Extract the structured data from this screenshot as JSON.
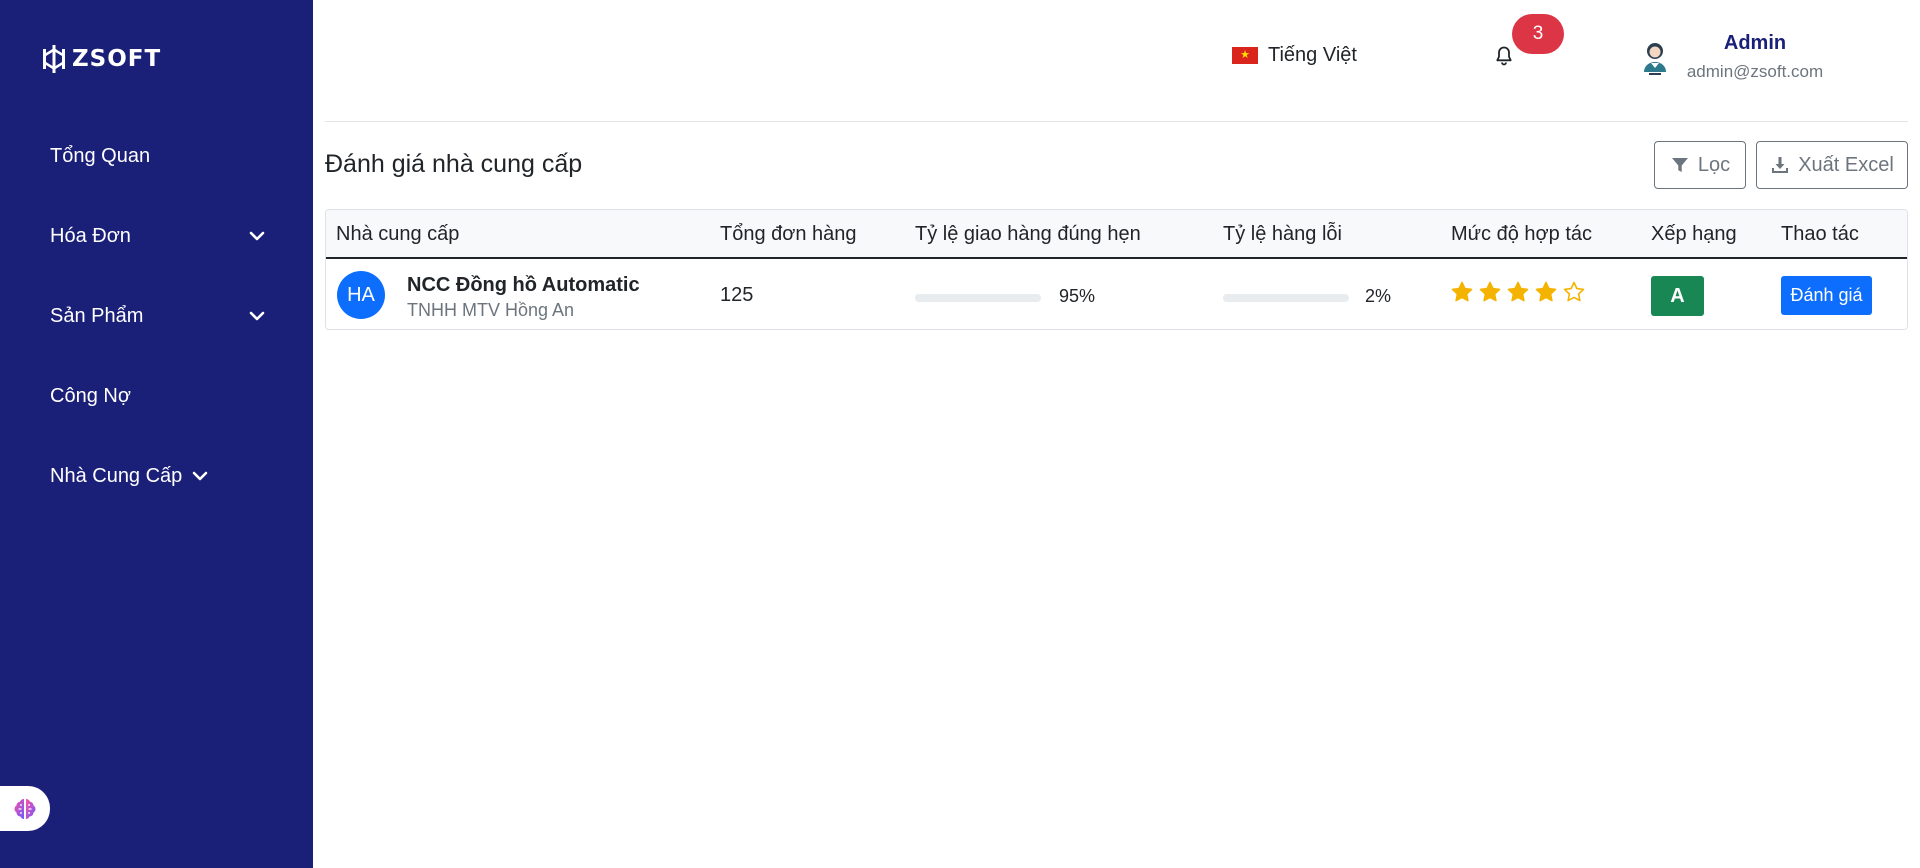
{
  "sidebar": {
    "logo_text": "ZSOFT",
    "items": [
      {
        "label": "Tổng Quan",
        "icon": "none"
      },
      {
        "label": "Hóa Đơn",
        "icon": "chevron-down-icon"
      },
      {
        "label": "Sản Phẩm",
        "icon": "chevron-down-icon"
      },
      {
        "label": "Công Nợ",
        "icon": "none"
      },
      {
        "label": "Nhà Cung Cấp",
        "icon": "chevron-down-icon"
      }
    ],
    "bg_color": "#1a1f78"
  },
  "header": {
    "language": "Tiếng Việt",
    "notification_count": "3",
    "user": {
      "name": "Admin",
      "email": "admin@zsoft.com"
    }
  },
  "page": {
    "title": "Đánh giá nhà cung cấp",
    "filter_label": "Lọc",
    "export_label": "Xuất Excel"
  },
  "table": {
    "columns": [
      "Nhà cung cấp",
      "Tổng đơn hàng",
      "Tỷ lệ giao hàng đúng hẹn",
      "Tỷ lệ hàng lỗi",
      "Mức độ hợp tác",
      "Xếp hạng",
      "Thao tác"
    ],
    "rows": [
      {
        "avatar_initials": "HA",
        "supplier_name": "NCC Đồng hồ Automatic",
        "company": "TNHH MTV Hồng An",
        "total_orders": "125",
        "on_time_rate": "95%",
        "on_time_value": 0.95,
        "defect_rate": "2%",
        "defect_value": 0.02,
        "cooperation_stars": 4,
        "cooperation_max": 5,
        "rank": "A",
        "action_label": "Đánh giá"
      }
    ]
  },
  "colors": {
    "accent": "#0d6efd",
    "rank_green": "#198754",
    "badge_red": "#dc3545",
    "star_gold": "#f5b301"
  }
}
